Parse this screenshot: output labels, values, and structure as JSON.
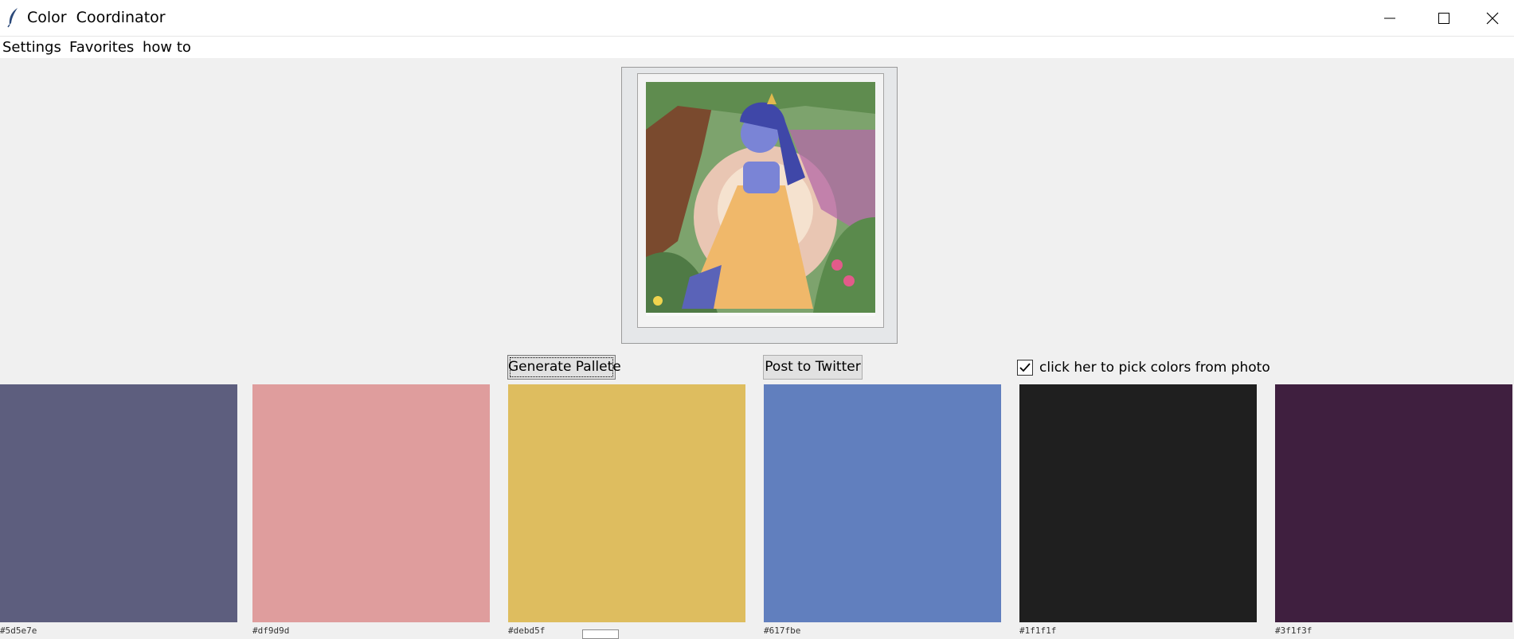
{
  "window": {
    "title": "Color  Coordinator",
    "icon": "feather-icon",
    "controls": [
      "minimize-icon",
      "maximize-icon",
      "close-icon"
    ]
  },
  "menu": {
    "items": [
      {
        "label": "Settings"
      },
      {
        "label": "Favorites"
      },
      {
        "label": "how to"
      }
    ]
  },
  "photo": {
    "description_icon": "image-preview"
  },
  "actions": {
    "generate_label": "Generate Pallete",
    "twitter_label": "Post to Twitter",
    "pick_from_photo_label": "click her to pick colors from photo",
    "pick_from_photo_checked": true
  },
  "palette": {
    "swatches": [
      {
        "color": "#5d5e7e",
        "hex_label": "#5d5e7e"
      },
      {
        "color": "#df9d9d",
        "hex_label": "#df9d9d"
      },
      {
        "color": "#debd5f",
        "hex_label": "#debd5f"
      },
      {
        "color": "#617fbe",
        "hex_label": "#617fbe"
      },
      {
        "color": "#1f1f1f",
        "hex_label": "#1f1f1f"
      },
      {
        "color": "#3f1f3f",
        "hex_label": "#3f1f3f"
      }
    ]
  }
}
